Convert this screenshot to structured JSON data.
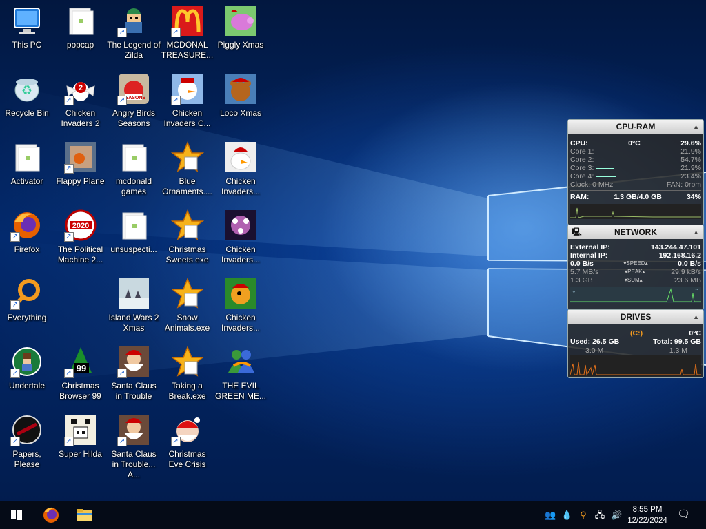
{
  "desktop": {
    "icons": [
      {
        "label": "This PC",
        "col": 0,
        "row": 0,
        "kind": "pc",
        "shortcut": false
      },
      {
        "label": "Recycle Bin",
        "col": 0,
        "row": 1,
        "kind": "recycle",
        "shortcut": false
      },
      {
        "label": "Activator",
        "col": 0,
        "row": 2,
        "kind": "folder",
        "shortcut": false
      },
      {
        "label": "Firefox",
        "col": 0,
        "row": 3,
        "kind": "firefox",
        "shortcut": true
      },
      {
        "label": "Everything",
        "col": 0,
        "row": 4,
        "kind": "everything",
        "shortcut": true
      },
      {
        "label": "Undertale",
        "col": 0,
        "row": 5,
        "kind": "undertale",
        "shortcut": true
      },
      {
        "label": "Papers, Please",
        "col": 0,
        "row": 6,
        "kind": "papers",
        "shortcut": true
      },
      {
        "label": "popcap",
        "col": 1,
        "row": 0,
        "kind": "folder",
        "shortcut": false
      },
      {
        "label": "Chicken Invaders 2",
        "col": 1,
        "row": 1,
        "kind": "chicken",
        "shortcut": true
      },
      {
        "label": "Flappy Plane",
        "col": 1,
        "row": 2,
        "kind": "photo",
        "shortcut": true
      },
      {
        "label": "The Political Machine 2...",
        "col": 1,
        "row": 3,
        "kind": "political",
        "shortcut": true
      },
      {
        "label": "Christmas Browser 99",
        "col": 1,
        "row": 5,
        "kind": "xmastree",
        "shortcut": true
      },
      {
        "label": "Super Hilda",
        "col": 1,
        "row": 6,
        "kind": "hilda",
        "shortcut": true
      },
      {
        "label": "The Legend of Zilda",
        "col": 2,
        "row": 0,
        "kind": "zilda",
        "shortcut": true
      },
      {
        "label": "Angry Birds Seasons",
        "col": 2,
        "row": 1,
        "kind": "angry",
        "shortcut": true
      },
      {
        "label": "mcdonald games",
        "col": 2,
        "row": 2,
        "kind": "folder",
        "shortcut": false
      },
      {
        "label": "unsuspecti...",
        "col": 2,
        "row": 3,
        "kind": "folder",
        "shortcut": false
      },
      {
        "label": "Island Wars 2 Xmas",
        "col": 2,
        "row": 4,
        "kind": "island",
        "shortcut": false
      },
      {
        "label": "Santa Claus in Trouble",
        "col": 2,
        "row": 5,
        "kind": "santa",
        "shortcut": true
      },
      {
        "label": "Santa Claus in Trouble... A...",
        "col": 2,
        "row": 6,
        "kind": "santa",
        "shortcut": true
      },
      {
        "label": "MCDONAL TREASURE...",
        "col": 3,
        "row": 0,
        "kind": "mcd",
        "shortcut": true
      },
      {
        "label": "Chicken Invaders C...",
        "col": 3,
        "row": 1,
        "kind": "snowman",
        "shortcut": true
      },
      {
        "label": "Blue Ornaments....",
        "col": 3,
        "row": 2,
        "kind": "star",
        "shortcut": false
      },
      {
        "label": "Christmas Sweets.exe",
        "col": 3,
        "row": 3,
        "kind": "star",
        "shortcut": false
      },
      {
        "label": "Snow Animals.exe",
        "col": 3,
        "row": 4,
        "kind": "star",
        "shortcut": false
      },
      {
        "label": "Taking a Break.exe",
        "col": 3,
        "row": 5,
        "kind": "star",
        "shortcut": false
      },
      {
        "label": "Christmas Eve Crisis",
        "col": 3,
        "row": 6,
        "kind": "santa2",
        "shortcut": true
      },
      {
        "label": "Piggly Xmas",
        "col": 4,
        "row": 0,
        "kind": "piggy",
        "shortcut": false
      },
      {
        "label": "Loco Xmas",
        "col": 4,
        "row": 1,
        "kind": "bear",
        "shortcut": false
      },
      {
        "label": "Chicken Invaders...",
        "col": 4,
        "row": 2,
        "kind": "chicken2",
        "shortcut": false
      },
      {
        "label": "Chicken Invaders...",
        "col": 4,
        "row": 3,
        "kind": "chicken3",
        "shortcut": false
      },
      {
        "label": "Chicken Invaders...",
        "col": 4,
        "row": 4,
        "kind": "chicken4",
        "shortcut": false
      },
      {
        "label": "THE EVIL GREEN ME...",
        "col": 4,
        "row": 5,
        "kind": "msn",
        "shortcut": false
      }
    ]
  },
  "cpu_ram": {
    "title": "CPU-RAM",
    "cpu_label": "CPU:",
    "temp": "0°C",
    "cpu_pct": "29.6%",
    "cores": [
      {
        "label": "Core 1:",
        "value": "21.9%",
        "level": 0.219
      },
      {
        "label": "Core 2:",
        "value": "54.7%",
        "level": 0.547
      },
      {
        "label": "Core 3:",
        "value": "21.9%",
        "level": 0.219
      },
      {
        "label": "Core 4:",
        "value": "23.4%",
        "level": 0.234
      }
    ],
    "clock": "Clock: 0 MHz",
    "fan": "FAN: 0rpm",
    "ram_label": "RAM:",
    "ram_value": "1.3 GB/4.0 GB",
    "ram_pct": "34%"
  },
  "network": {
    "title": "NETWORK",
    "external_label": "External IP:",
    "external_ip": "143.244.47.101",
    "internal_label": "Internal IP:",
    "internal_ip": "192.168.16.2",
    "speed_left": "0.0 B/s",
    "speed_mid": "SPEED",
    "speed_right": "0.0 B/s",
    "peak_left": "5.7 MB/s",
    "peak_mid": "PEAK",
    "peak_right": "29.9 kB/s",
    "sum_left": "1.3 GB",
    "sum_mid": "SUM",
    "sum_right": "23.6 MB"
  },
  "drives": {
    "title": "DRIVES",
    "drive": "(C:)",
    "temp": "0°C",
    "used": "Used: 26.5 GB",
    "total": "Total: 99.5 GB",
    "read": "3.0 M",
    "write": "1.3 M"
  },
  "taskbar": {
    "time": "8:55 PM",
    "date": "12/22/2024"
  },
  "colors": {
    "accent": "#1e78d7",
    "gadget_bg": "#282828",
    "orange": "#f39a1e"
  }
}
